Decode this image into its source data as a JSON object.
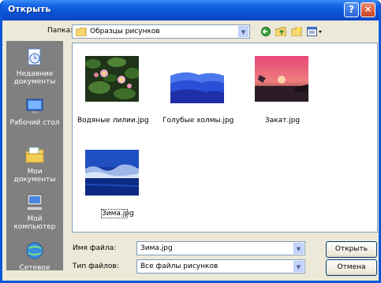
{
  "window": {
    "title": "Открыть"
  },
  "toolbar": {
    "lookin_label": "Папка:",
    "lookin_value": "Образцы рисунков",
    "icons": [
      "back-icon",
      "up-folder-icon",
      "new-folder-icon",
      "views-menu-icon"
    ]
  },
  "places": [
    {
      "label": "Недавние документы",
      "icon": "recent-documents-icon"
    },
    {
      "label": "Рабочий стол",
      "icon": "desktop-icon"
    },
    {
      "label": "Мои документы",
      "icon": "my-documents-icon"
    },
    {
      "label": "Мой компьютер",
      "icon": "my-computer-icon"
    },
    {
      "label": "Сетевое",
      "icon": "network-icon"
    }
  ],
  "files": [
    {
      "name": "Водяные лилии.jpg"
    },
    {
      "name": "Голубые холмы.jpg"
    },
    {
      "name": "Закат.jpg"
    },
    {
      "name": "Зима.jpg",
      "selected": true
    }
  ],
  "filename": {
    "label": "Имя файла:",
    "value": "Зима.jpg"
  },
  "filetype": {
    "label": "Тип файлов:",
    "value": "Все файлы рисунков"
  },
  "buttons": {
    "open": "Открыть",
    "cancel": "Отмена"
  },
  "colors": {
    "titlebar": "#0a4fd1",
    "frame": "#0a57d8",
    "dialog_bg": "#ece9d8",
    "places_bg": "#808080"
  }
}
